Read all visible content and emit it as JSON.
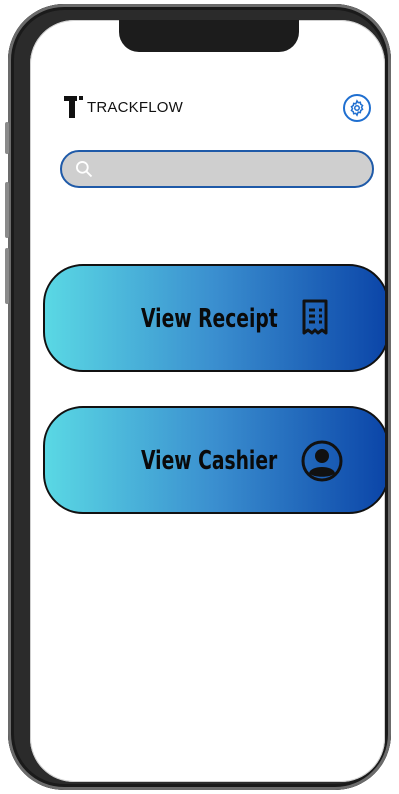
{
  "brand": {
    "name": "TRACKFLOW"
  },
  "settings": {
    "icon": "gear-icon"
  },
  "search": {
    "placeholder": "",
    "value": "",
    "icon": "search-icon"
  },
  "actions": [
    {
      "label": "View Receipt",
      "icon": "receipt-icon"
    },
    {
      "label": "View Cashier",
      "icon": "user-avatar-icon"
    }
  ],
  "colors": {
    "gradient_start": "#5ad8e4",
    "gradient_end": "#0b45a8",
    "accent": "#1f6fd0"
  }
}
